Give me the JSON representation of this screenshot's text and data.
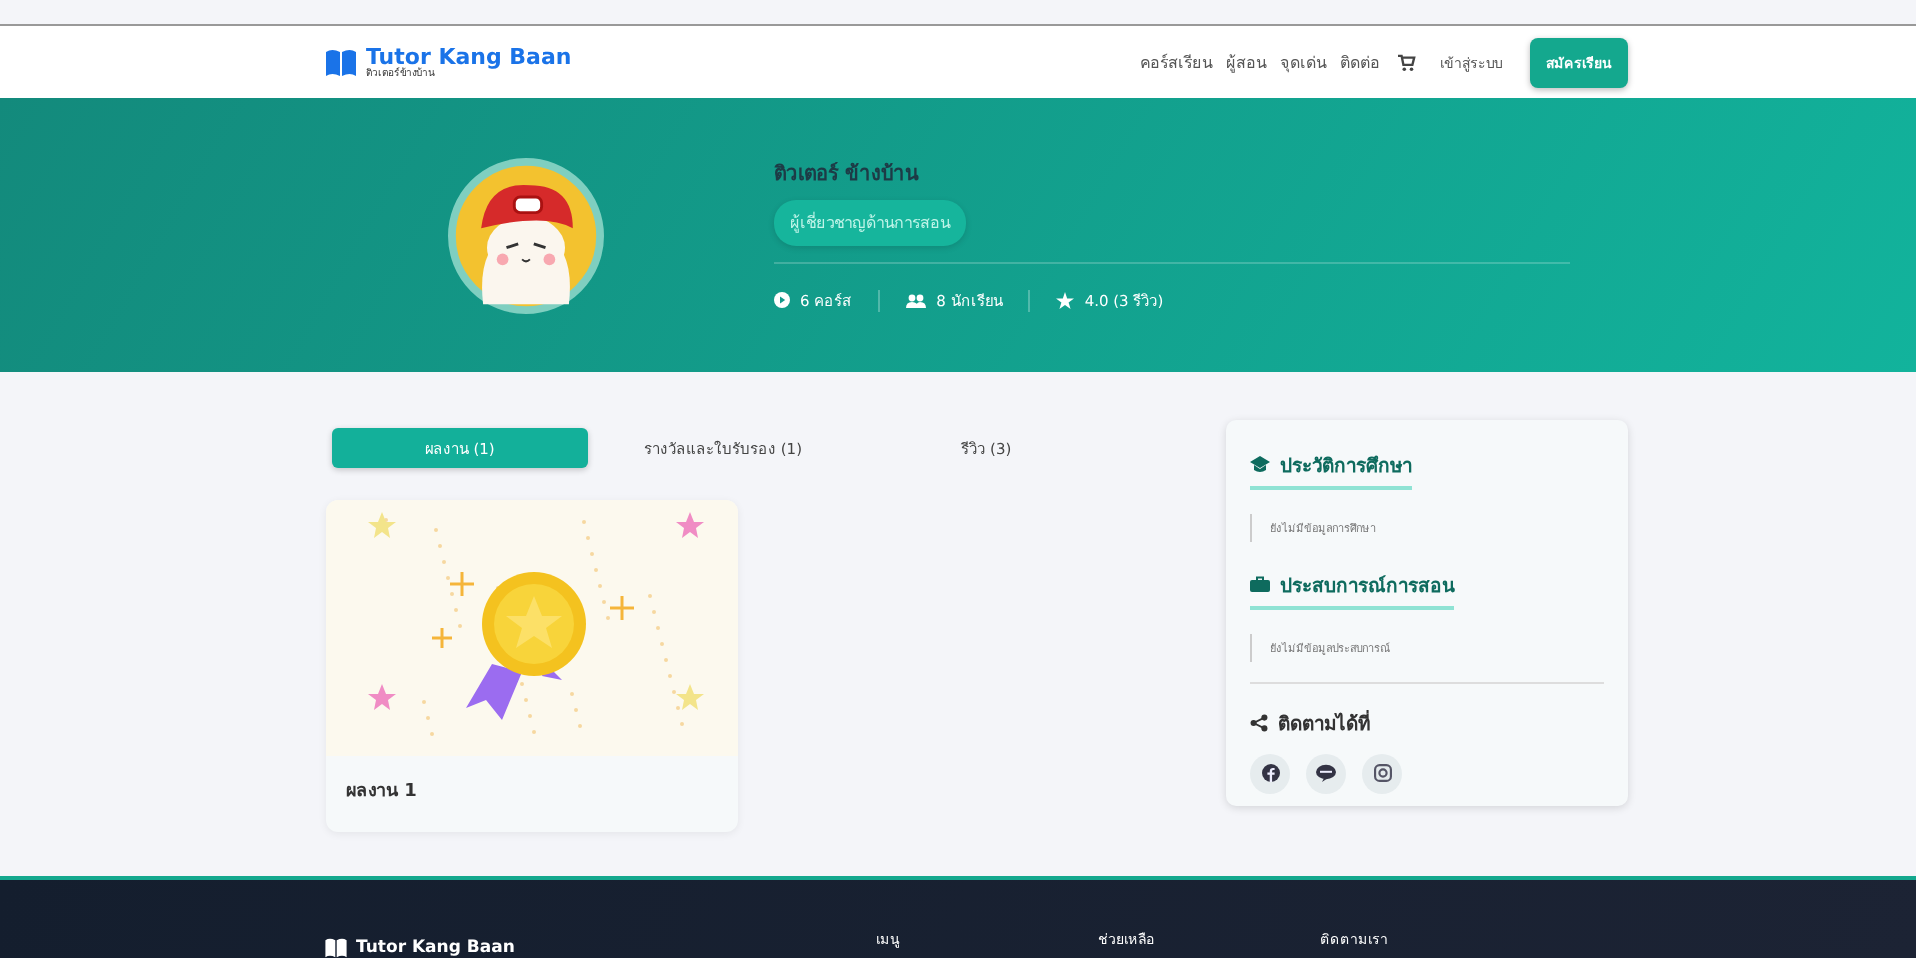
{
  "navbar": {
    "logo": {
      "title": "Tutor Kang Baan",
      "subtitle": "ติวเตอร์ข้างบ้าน"
    },
    "links": [
      "คอร์สเรียน",
      "ผู้สอน",
      "จุดเด่น",
      "ติดต่อ"
    ],
    "login": "เข้าสู่ระบบ",
    "signup": "สมัครเรียน"
  },
  "profile": {
    "name": "ติวเตอร์ ข้างบ้าน",
    "badge": "ผู้เชี่ยวชาญด้านการสอน",
    "stats": [
      {
        "kind": "courses",
        "text": "6 คอร์ส"
      },
      {
        "kind": "students",
        "text": "8 นักเรียน"
      },
      {
        "kind": "rating",
        "text": "4.0 (3 รีวิว)"
      }
    ]
  },
  "tabs": [
    {
      "label": "ผลงาน (1)",
      "selected": true
    },
    {
      "label": "รางวัลและใบรับรอง (1)",
      "selected": false
    },
    {
      "label": "รีวิว (3)",
      "selected": false
    }
  ],
  "works": [
    {
      "title": "ผลงาน 1"
    }
  ],
  "sidebar": {
    "sections": [
      {
        "kind": "education",
        "heading": "ประวัติการศึกษา",
        "text": "ยังไม่มีข้อมูลการศึกษา"
      },
      {
        "kind": "experience",
        "heading": "ประสบการณ์การสอน",
        "text": "ยังไม่มีข้อมูลประสบการณ์"
      }
    ],
    "social": {
      "heading": "ติดตามได้ที่",
      "links": [
        {
          "kind": "facebook"
        },
        {
          "kind": "line"
        },
        {
          "kind": "instagram"
        }
      ]
    }
  },
  "footer": {
    "logo": "Tutor Kang Baan",
    "columns": [
      "เมนู",
      "ช่วยเหลือ",
      "ติดตามเรา"
    ]
  }
}
